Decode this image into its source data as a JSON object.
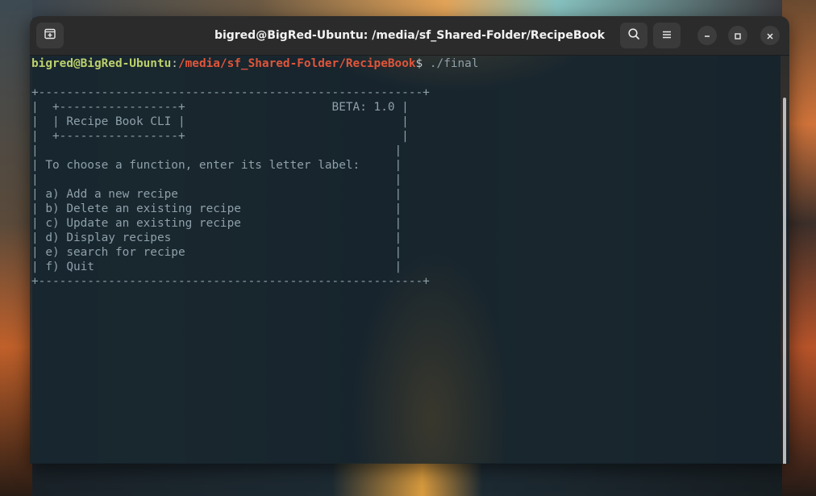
{
  "window": {
    "title": "bigred@BigRed-Ubuntu: /media/sf_Shared-Folder/RecipeBook"
  },
  "prompt": {
    "user_host": "bigred@BigRed-Ubuntu",
    "colon": ":",
    "path": "/media/sf_Shared-Folder/RecipeBook",
    "dollar": "$",
    "command": " ./final"
  },
  "output": {
    "lines": [
      "",
      "+-------------------------------------------------------+",
      "|  +-----------------+                     BETA: 1.0 |",
      "|  | Recipe Book CLI |                               |",
      "|  +-----------------+                               |",
      "|                                                   |",
      "| To choose a function, enter its letter label:     |",
      "|                                                   |",
      "| a) Add a new recipe                               |",
      "| b) Delete an existing recipe                      |",
      "| c) Update an existing recipe                      |",
      "| d) Display recipes                                |",
      "| e) search for recipe                              |",
      "| f) Quit                                           |",
      "+-------------------------------------------------------+"
    ]
  },
  "icons": {
    "new_tab": "new-tab-icon",
    "search": "search-icon",
    "menu": "hamburger-menu-icon",
    "minimize": "minimize-icon",
    "maximize": "maximize-icon",
    "close": "close-icon"
  }
}
